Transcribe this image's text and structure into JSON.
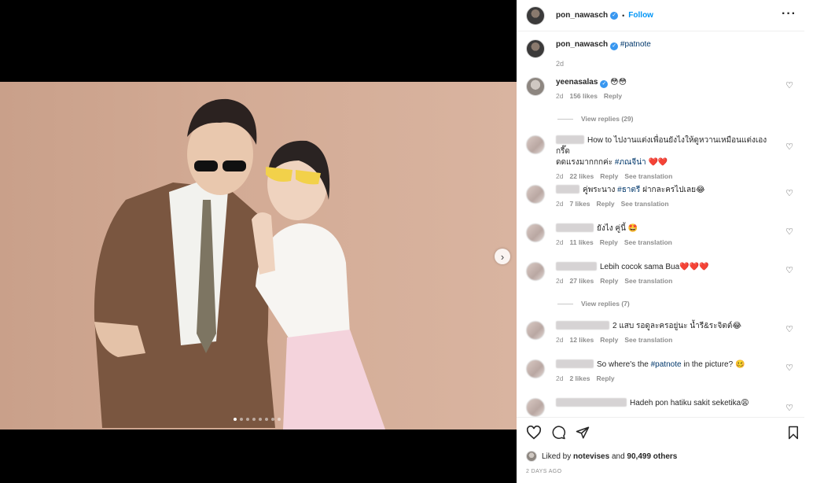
{
  "post": {
    "username": "pon_nawasch",
    "follow_label": "Follow",
    "more_icon": "more-icon",
    "caption_hashtag": "#patnote",
    "caption_age": "2d",
    "carousel": {
      "total": 8,
      "active_index": 0
    }
  },
  "comments": [
    {
      "user": "yeenasalas",
      "verified": true,
      "text": "😳😳",
      "age": "2d",
      "likes": "156 likes",
      "reply": "Reply",
      "translate": "",
      "view_replies": "View replies (29)"
    },
    {
      "user": "",
      "text_1": "How to ไปงานแต่งเพื่อนยังไงให้ดูหวานเหมือนแต่งเอง กรี๊ด",
      "text_2": "ดดแรงมากกกค่ะ",
      "hashtag": "#ภณจีน่า",
      "hearts": "❤️❤️",
      "age": "2d",
      "likes": "22 likes",
      "reply": "Reply",
      "translate": "See translation"
    },
    {
      "user": "",
      "text_a": "คู่พระนาง",
      "hashtag": "#ธาตรี",
      "text_b": "ฝากละครไปเลย😂",
      "age": "2d",
      "likes": "7 likes",
      "reply": "Reply",
      "translate": "See translation"
    },
    {
      "user": "",
      "text": "ยังไง คู่นี้ 🤩",
      "age": "2d",
      "likes": "11 likes",
      "reply": "Reply",
      "translate": "See translation"
    },
    {
      "user": "",
      "text": "Lebih cocok sama Bua❤️❤️❤️",
      "age": "2d",
      "likes": "27 likes",
      "reply": "Reply",
      "translate": "See translation",
      "view_replies": "View replies (7)"
    },
    {
      "user": "",
      "text": "2 แสบ รอดูละครอยู่นะ น้ำรี&ระจิตต์😂",
      "age": "2d",
      "likes": "12 likes",
      "reply": "Reply",
      "translate": "See translation"
    },
    {
      "user": "",
      "text_a": "So where's the",
      "hashtag": "#patnote",
      "text_b": "in the picture? 🥴",
      "age": "2d",
      "likes": "2 likes",
      "reply": "Reply"
    },
    {
      "user": "",
      "text": "Hadeh pon hatiku sakit seketika😩"
    }
  ],
  "actions": {
    "icons": [
      "heart-icon",
      "comment-icon",
      "share-icon",
      "bookmark-icon"
    ],
    "liked_by_prefix": "Liked by",
    "liked_by_user": "notevises",
    "liked_by_and": "and",
    "liked_by_count": "90,499 others",
    "posted_ago": "2 DAYS AGO"
  },
  "colors": {
    "link": "#0095f6",
    "hashtag": "#00376b",
    "muted": "#8e8e8e",
    "verified": "#3897f0"
  }
}
